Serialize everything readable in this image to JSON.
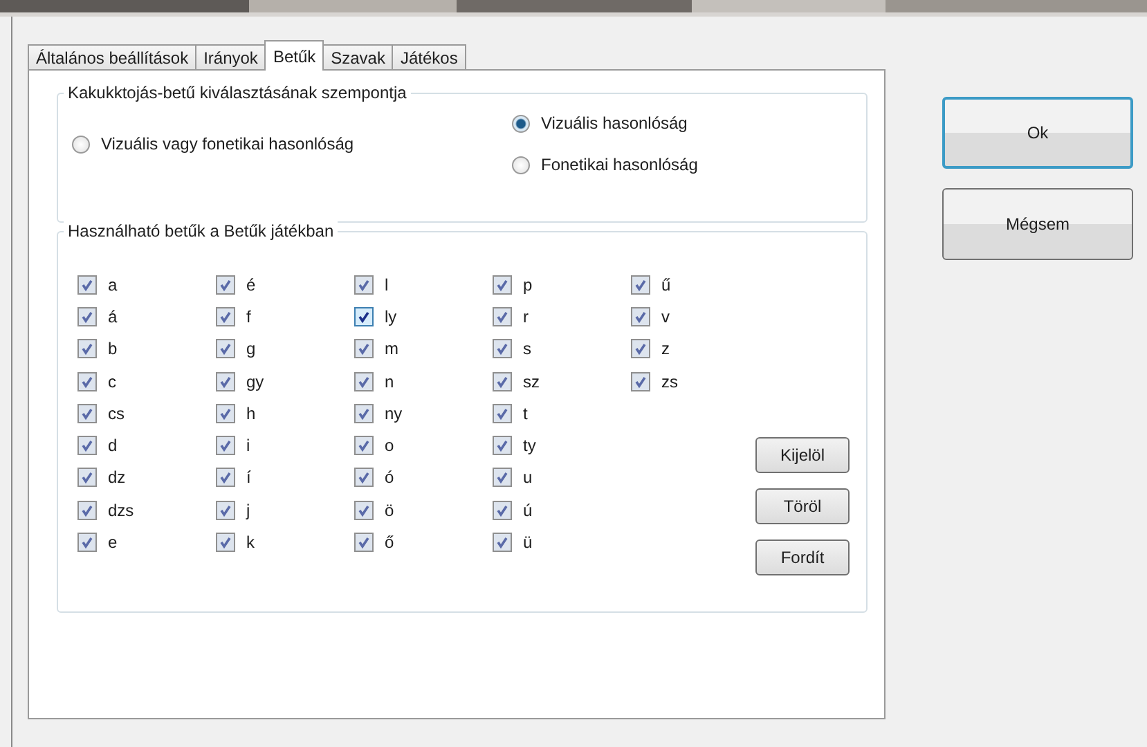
{
  "tabs": [
    {
      "label": "Általános beállítások",
      "selected": false
    },
    {
      "label": "Irányok",
      "selected": false
    },
    {
      "label": "Betűk",
      "selected": true
    },
    {
      "label": "Szavak",
      "selected": false
    },
    {
      "label": "Játékos",
      "selected": false
    }
  ],
  "criterion_group": {
    "title": "Kakukktojás-betű kiválasztásának szempontja",
    "options": [
      {
        "label": "Vizuális vagy fonetikai hasonlóság",
        "selected": false
      },
      {
        "label": "Vizuális hasonlóság",
        "selected": true
      },
      {
        "label": "Fonetikai hasonlóság",
        "selected": false
      }
    ]
  },
  "letters_group": {
    "title": "Használható betűk a Betűk játékban",
    "letters": [
      {
        "label": "a",
        "checked": true,
        "hovered": false
      },
      {
        "label": "á",
        "checked": true,
        "hovered": false
      },
      {
        "label": "b",
        "checked": true,
        "hovered": false
      },
      {
        "label": "c",
        "checked": true,
        "hovered": false
      },
      {
        "label": "cs",
        "checked": true,
        "hovered": false
      },
      {
        "label": "d",
        "checked": true,
        "hovered": false
      },
      {
        "label": "dz",
        "checked": true,
        "hovered": false
      },
      {
        "label": "dzs",
        "checked": true,
        "hovered": false
      },
      {
        "label": "e",
        "checked": true,
        "hovered": false
      },
      {
        "label": "é",
        "checked": true,
        "hovered": false
      },
      {
        "label": "f",
        "checked": true,
        "hovered": false
      },
      {
        "label": "g",
        "checked": true,
        "hovered": false
      },
      {
        "label": "gy",
        "checked": true,
        "hovered": false
      },
      {
        "label": "h",
        "checked": true,
        "hovered": false
      },
      {
        "label": "i",
        "checked": true,
        "hovered": false
      },
      {
        "label": "í",
        "checked": true,
        "hovered": false
      },
      {
        "label": "j",
        "checked": true,
        "hovered": false
      },
      {
        "label": "k",
        "checked": true,
        "hovered": false
      },
      {
        "label": "l",
        "checked": true,
        "hovered": false
      },
      {
        "label": "ly",
        "checked": true,
        "hovered": true
      },
      {
        "label": "m",
        "checked": true,
        "hovered": false
      },
      {
        "label": "n",
        "checked": true,
        "hovered": false
      },
      {
        "label": "ny",
        "checked": true,
        "hovered": false
      },
      {
        "label": "o",
        "checked": true,
        "hovered": false
      },
      {
        "label": "ó",
        "checked": true,
        "hovered": false
      },
      {
        "label": "ö",
        "checked": true,
        "hovered": false
      },
      {
        "label": "ő",
        "checked": true,
        "hovered": false
      },
      {
        "label": "p",
        "checked": true,
        "hovered": false
      },
      {
        "label": "r",
        "checked": true,
        "hovered": false
      },
      {
        "label": "s",
        "checked": true,
        "hovered": false
      },
      {
        "label": "sz",
        "checked": true,
        "hovered": false
      },
      {
        "label": "t",
        "checked": true,
        "hovered": false
      },
      {
        "label": "ty",
        "checked": true,
        "hovered": false
      },
      {
        "label": "u",
        "checked": true,
        "hovered": false
      },
      {
        "label": "ú",
        "checked": true,
        "hovered": false
      },
      {
        "label": "ü",
        "checked": true,
        "hovered": false
      },
      {
        "label": "ű",
        "checked": true,
        "hovered": false
      },
      {
        "label": "v",
        "checked": true,
        "hovered": false
      },
      {
        "label": "z",
        "checked": true,
        "hovered": false
      },
      {
        "label": "zs",
        "checked": true,
        "hovered": false
      }
    ],
    "buttons": [
      "Kijelöl",
      "Töröl",
      "Fordít"
    ]
  },
  "dialog_buttons": [
    {
      "label": "Ok",
      "default": true
    },
    {
      "label": "Mégsem",
      "default": false
    }
  ]
}
